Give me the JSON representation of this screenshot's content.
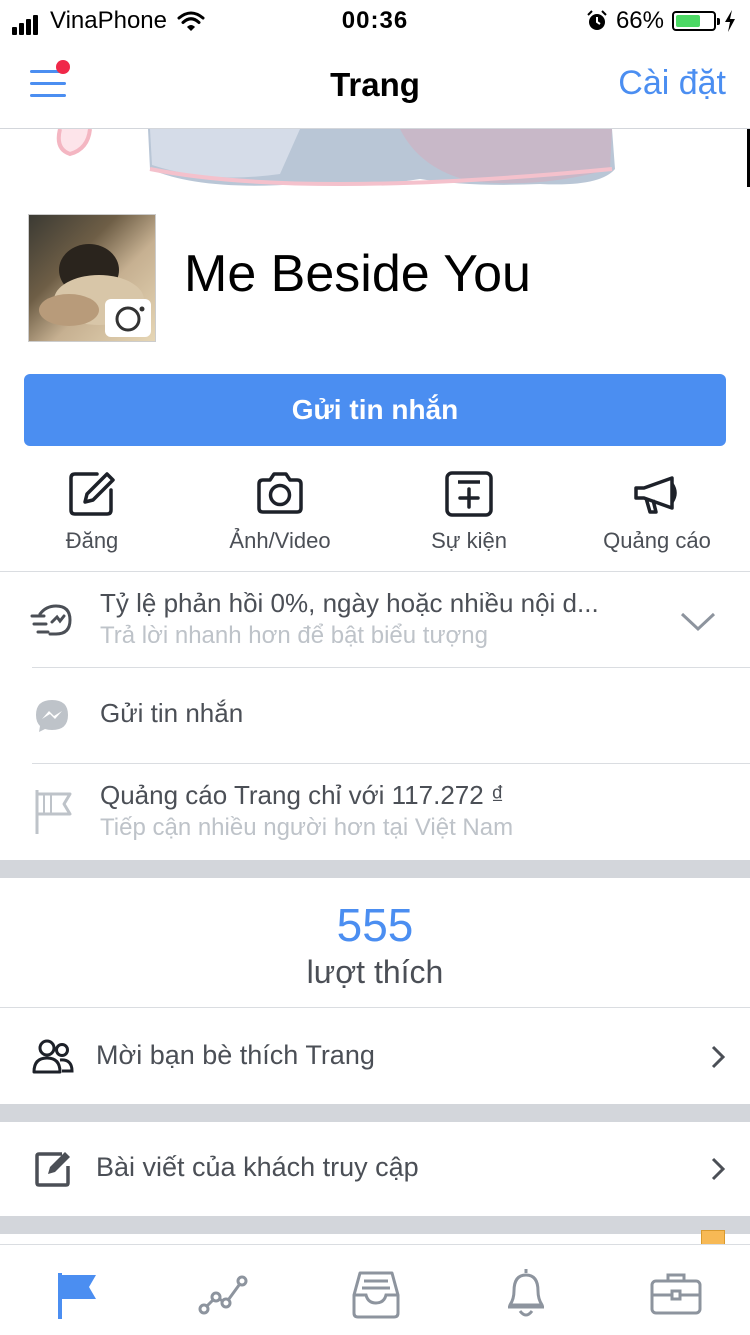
{
  "status_bar": {
    "carrier": "VinaPhone",
    "time": "00:36",
    "battery_percent": "66%",
    "battery_level": 0.66
  },
  "nav": {
    "title": "Trang",
    "settings_label": "Cài đặt"
  },
  "page": {
    "name": "Me Beside You"
  },
  "message_button": "Gửi tin nhắn",
  "actions": [
    {
      "label": "Đăng",
      "icon": "edit-icon"
    },
    {
      "label": "Ảnh/Video",
      "icon": "camera-icon"
    },
    {
      "label": "Sự kiện",
      "icon": "event-add-icon"
    },
    {
      "label": "Quảng cáo",
      "icon": "megaphone-icon"
    }
  ],
  "info_rows": {
    "response": {
      "title": "Tỷ lệ phản hồi 0%, ngày hoặc nhiều nội d...",
      "subtitle": "Trả lời nhanh hơn để bật biểu tượng",
      "icon": "fast-response-icon"
    },
    "messenger": {
      "title": "Gửi tin nhắn",
      "icon": "messenger-icon"
    },
    "promote": {
      "title": "Quảng cáo Trang chỉ với 117.272 ₫",
      "subtitle": "Tiếp cận nhiều người hơn tại Việt Nam",
      "icon": "promote-flag-icon"
    }
  },
  "likes": {
    "count": "555",
    "label": "lượt thích"
  },
  "list": [
    {
      "label": "Mời bạn bè thích Trang",
      "icon": "invite-friends-icon"
    },
    {
      "label": "Bài viết của khách truy cập",
      "icon": "visitor-posts-icon"
    }
  ],
  "tabs": [
    {
      "icon": "page-flag-icon",
      "active": true
    },
    {
      "icon": "insights-icon",
      "active": false
    },
    {
      "icon": "inbox-icon",
      "active": false
    },
    {
      "icon": "notifications-bell-icon",
      "active": false
    },
    {
      "icon": "tools-briefcase-icon",
      "active": false
    }
  ],
  "colors": {
    "accent": "#4b8ef1",
    "notification_dot": "#f02849",
    "battery_fill": "#4cd964"
  }
}
